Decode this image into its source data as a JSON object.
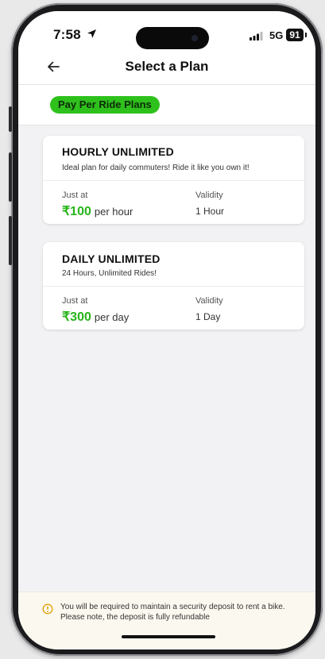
{
  "status_bar": {
    "time": "7:58",
    "network": "5G",
    "battery": "91"
  },
  "header": {
    "title": "Select a Plan"
  },
  "section": {
    "label": "Pay Per Ride Plans"
  },
  "plans": [
    {
      "name": "HOURLY UNLIMITED",
      "description": "Ideal plan for daily commuters! Ride it like you own it!",
      "price_label": "Just at",
      "price": "₹100",
      "price_unit": "per hour",
      "validity_label": "Validity",
      "validity": "1 Hour"
    },
    {
      "name": "DAILY UNLIMITED",
      "description": "24 Hours, Unlimited Rides!",
      "price_label": "Just at",
      "price": "₹300",
      "price_unit": "per day",
      "validity_label": "Validity",
      "validity": "1 Day"
    }
  ],
  "notice": {
    "text": "You will be required to maintain a security deposit to rent a bike. Please note, the deposit is fully refundable"
  },
  "colors": {
    "accent": "#2ec11c",
    "price": "#27b51a",
    "notice_bg": "#fbf8ef",
    "info": "#e0a100"
  },
  "icons": [
    "location-arrow-icon",
    "signal-icon",
    "battery-icon",
    "back-arrow-icon",
    "info-icon"
  ]
}
